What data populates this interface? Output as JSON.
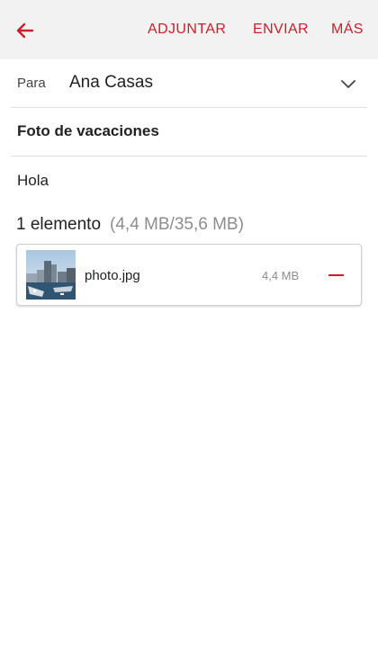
{
  "toolbar": {
    "attach_label": "ADJUNTAR",
    "send_label": "ENVIAR",
    "more_label": "MÁS"
  },
  "compose": {
    "to_label": "Para",
    "to_value": "Ana Casas",
    "subject": "Foto de vacaciones",
    "body": "Hola"
  },
  "attachments": {
    "count_label": "1 elemento",
    "size_summary": "(4,4 MB/35,6 MB)",
    "items": [
      {
        "name": "photo.jpg",
        "size": "4,4 MB"
      }
    ]
  },
  "colors": {
    "accent": "#c8202a",
    "appbar_bg": "#f2f2f2",
    "muted_text": "#8d8d8d"
  },
  "icons": {
    "back": "arrow-left-icon",
    "expand": "chevron-down-icon",
    "remove": "minus-icon",
    "thumbnail": "photo-thumbnail"
  }
}
